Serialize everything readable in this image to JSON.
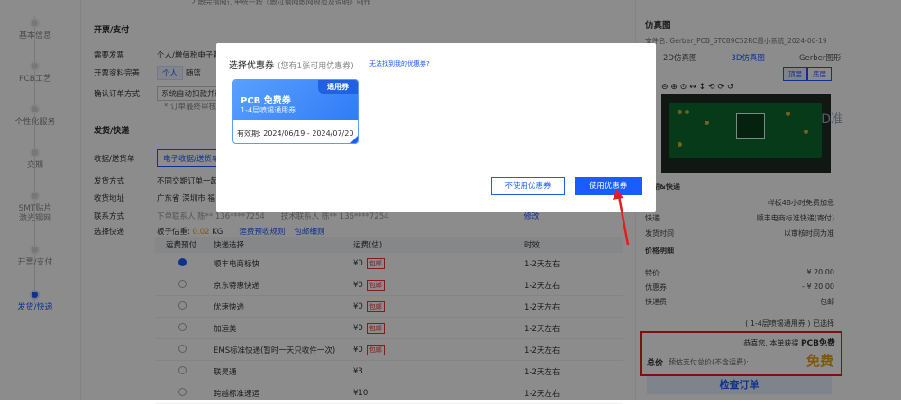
{
  "top_note": "2 敷完铜网订单统一按《敷过铜网敷网规范及说明》制作",
  "nav": {
    "items": [
      {
        "label": "基本信息"
      },
      {
        "label": "PCB工艺"
      },
      {
        "label": "个性化服务"
      },
      {
        "label": "交期"
      },
      {
        "label": "SMT贴片\n激光钢网"
      },
      {
        "label": "开票/支付"
      },
      {
        "label": "发货/快递"
      }
    ]
  },
  "invoice": {
    "section_title": "开票/支付",
    "need_invoice_label": "需要发票",
    "need_invoice_value": "个人/增值税电子普",
    "complete_label": "开票资料完善",
    "complete_options": [
      "个人",
      "随篮"
    ],
    "confirm_label": "确认订单方式",
    "confirm_value": "系统自动扣款并确",
    "confirm_note": "* 订单最终审核"
  },
  "shipping": {
    "section_title": "发货/快递",
    "receipt_label": "收据/送货单",
    "receipt_button": "电子收据/送货单",
    "method_label": "发货方式",
    "method_value": "不同交期订单一起",
    "address_label": "收货地址",
    "address_value": "广东省   深圳市   福",
    "contact_label": "联系方式",
    "contact_value": "下单联系人  陈**    136****7254",
    "contact_value2": "技术联系人  陈**    136****7254",
    "edit_link": "修改",
    "express_label": "选择快递",
    "weight_text": "板子估重:",
    "weight_value": "0.02",
    "weight_unit": "KG",
    "rule1": "运费预收规则",
    "rule2": "包邮细则",
    "table_headers": [
      "运费预付",
      "快递选择",
      "运费(估)",
      "时效"
    ],
    "rows": [
      {
        "name": "顺丰电商标快",
        "fee": "¥0",
        "tag": "包邮",
        "time": "1-2天左右",
        "selected": true
      },
      {
        "name": "京东特惠快递",
        "fee": "¥0",
        "tag": "包邮",
        "time": "1-2天左右",
        "selected": false
      },
      {
        "name": "优速快递",
        "fee": "¥0",
        "tag": "包邮",
        "time": "1-2天左右",
        "selected": false
      },
      {
        "name": "加运美",
        "fee": "¥0",
        "tag": "包邮",
        "time": "1-2天左右",
        "selected": false
      },
      {
        "name": "EMS标准快递(暂时一天只收件一次)",
        "fee": "¥0",
        "tag": "包邮",
        "time": "1-2天左右",
        "selected": false
      },
      {
        "name": "联昊通",
        "fee": "¥3",
        "tag": "",
        "time": "1-2天左右",
        "selected": false
      },
      {
        "name": "跨越标准速运",
        "fee": "¥10",
        "tag": "",
        "time": "1-2天左右",
        "selected": false
      }
    ]
  },
  "right_panel": {
    "title": "仿真图",
    "file": "文件名: Gerber_PCB_STC89C52RC最小系统_2024-06-19",
    "tabs": [
      "2D仿真图",
      "3D仿真图",
      "Gerber图形"
    ],
    "side_buttons": [
      "顶层",
      "底层"
    ],
    "tools": "⊖ ⊕ ⊙ ↔ ↕ ⟲ ⟳ ↺",
    "board_text": "D准",
    "delivery_title": "交期&快递",
    "kv": [
      {
        "k": "期",
        "v": "样板48小时免费加急"
      },
      {
        "k": "快递",
        "v": "顺丰电商标准快递(寄付)"
      },
      {
        "k": "发货时间",
        "v": "以审核时间为准"
      }
    ],
    "price_title": "价格明细",
    "price_rows": [
      {
        "k": "特价",
        "v": "¥ 20.00"
      },
      {
        "k": "优惠券",
        "v": "- ¥ 20.00"
      },
      {
        "k": "快递费",
        "v": "包邮"
      }
    ],
    "coupon_used": "( 1-4层喷锡通用券 ) 已选择",
    "congrats": "恭喜您, 本单获得",
    "congrats_highlight": "PCB免费",
    "total_label": "总价",
    "total_note": "预估支付总价(不含运费):",
    "total_value": "免费",
    "checkout": "检查订单"
  },
  "modal": {
    "title": "选择优惠券",
    "subtitle": "(您有1张可用优惠券)",
    "link": "无法找到我的优惠券?",
    "close": "×",
    "coupon": {
      "badge": "通用券",
      "name": "PCB 免费券",
      "desc": "1-4层喷锡通用券",
      "date": "有效期: 2024/06/19 - 2024/07/20"
    },
    "btn_cancel": "不使用优惠券",
    "btn_use": "使用优惠券"
  },
  "colors": {
    "accent": "#1a5cff",
    "danger": "#e02020",
    "price": "#e6a00a"
  }
}
